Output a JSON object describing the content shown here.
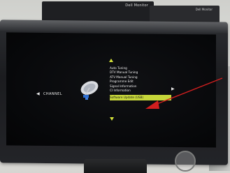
{
  "background": {
    "monitor_label": "Dell Monitor",
    "monitor2_label": "Dell Monitor"
  },
  "osd": {
    "channel_label": "CHANNEL",
    "left_arrow": "◀",
    "right_arrow": "▶",
    "menu_items": [
      "Auto Tuning",
      "DTV Manual Tuning",
      "ATV Manual Tuning",
      "Programme Edit",
      "Signal Information",
      "CI Information"
    ],
    "selected_item": "Software Update (USB)",
    "accent_color": "#c6d63a"
  },
  "annotation": {
    "arrow_color": "#d11f1f",
    "points_to": "selected-menu-item"
  }
}
